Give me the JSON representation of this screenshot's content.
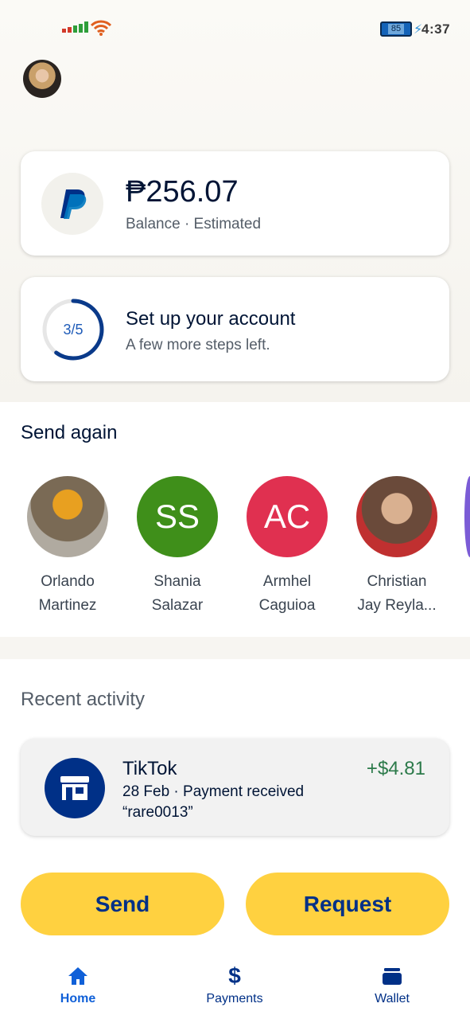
{
  "status_bar": {
    "time": "4:37",
    "battery_level": "85"
  },
  "balance": {
    "amount": "₱256.07",
    "caption": "Balance · Estimated"
  },
  "setup": {
    "progress_label": "3/5",
    "progress_fraction": 0.6,
    "title": "Set up your account",
    "subtitle": "A few more steps left."
  },
  "send_again": {
    "title": "Send again",
    "contacts": [
      {
        "initials": "",
        "first": "Orlando",
        "last": "Martinez",
        "color": "#8a8a8a"
      },
      {
        "initials": "SS",
        "first": "Shania",
        "last": "Salazar",
        "color": "#3f8f1a"
      },
      {
        "initials": "AC",
        "first": "Armhel",
        "last": "Caguioa",
        "color": "#e03050"
      },
      {
        "initials": "",
        "first": "Christian",
        "last": "Jay Reyla...",
        "color": "#c03030"
      }
    ]
  },
  "recent_activity": {
    "title": "Recent activity",
    "items": [
      {
        "merchant": "TikTok",
        "detail": "28 Feb · Payment received",
        "note": "“rare0013”",
        "amount": "+$4.81"
      }
    ]
  },
  "actions": {
    "send": "Send",
    "request": "Request"
  },
  "nav": {
    "home": "Home",
    "payments": "Payments",
    "wallet": "Wallet"
  },
  "colors": {
    "brand_navy": "#003087",
    "brand_yellow": "#ffd140",
    "positive_green": "#2c7a4a",
    "active_blue": "#1060d8"
  }
}
